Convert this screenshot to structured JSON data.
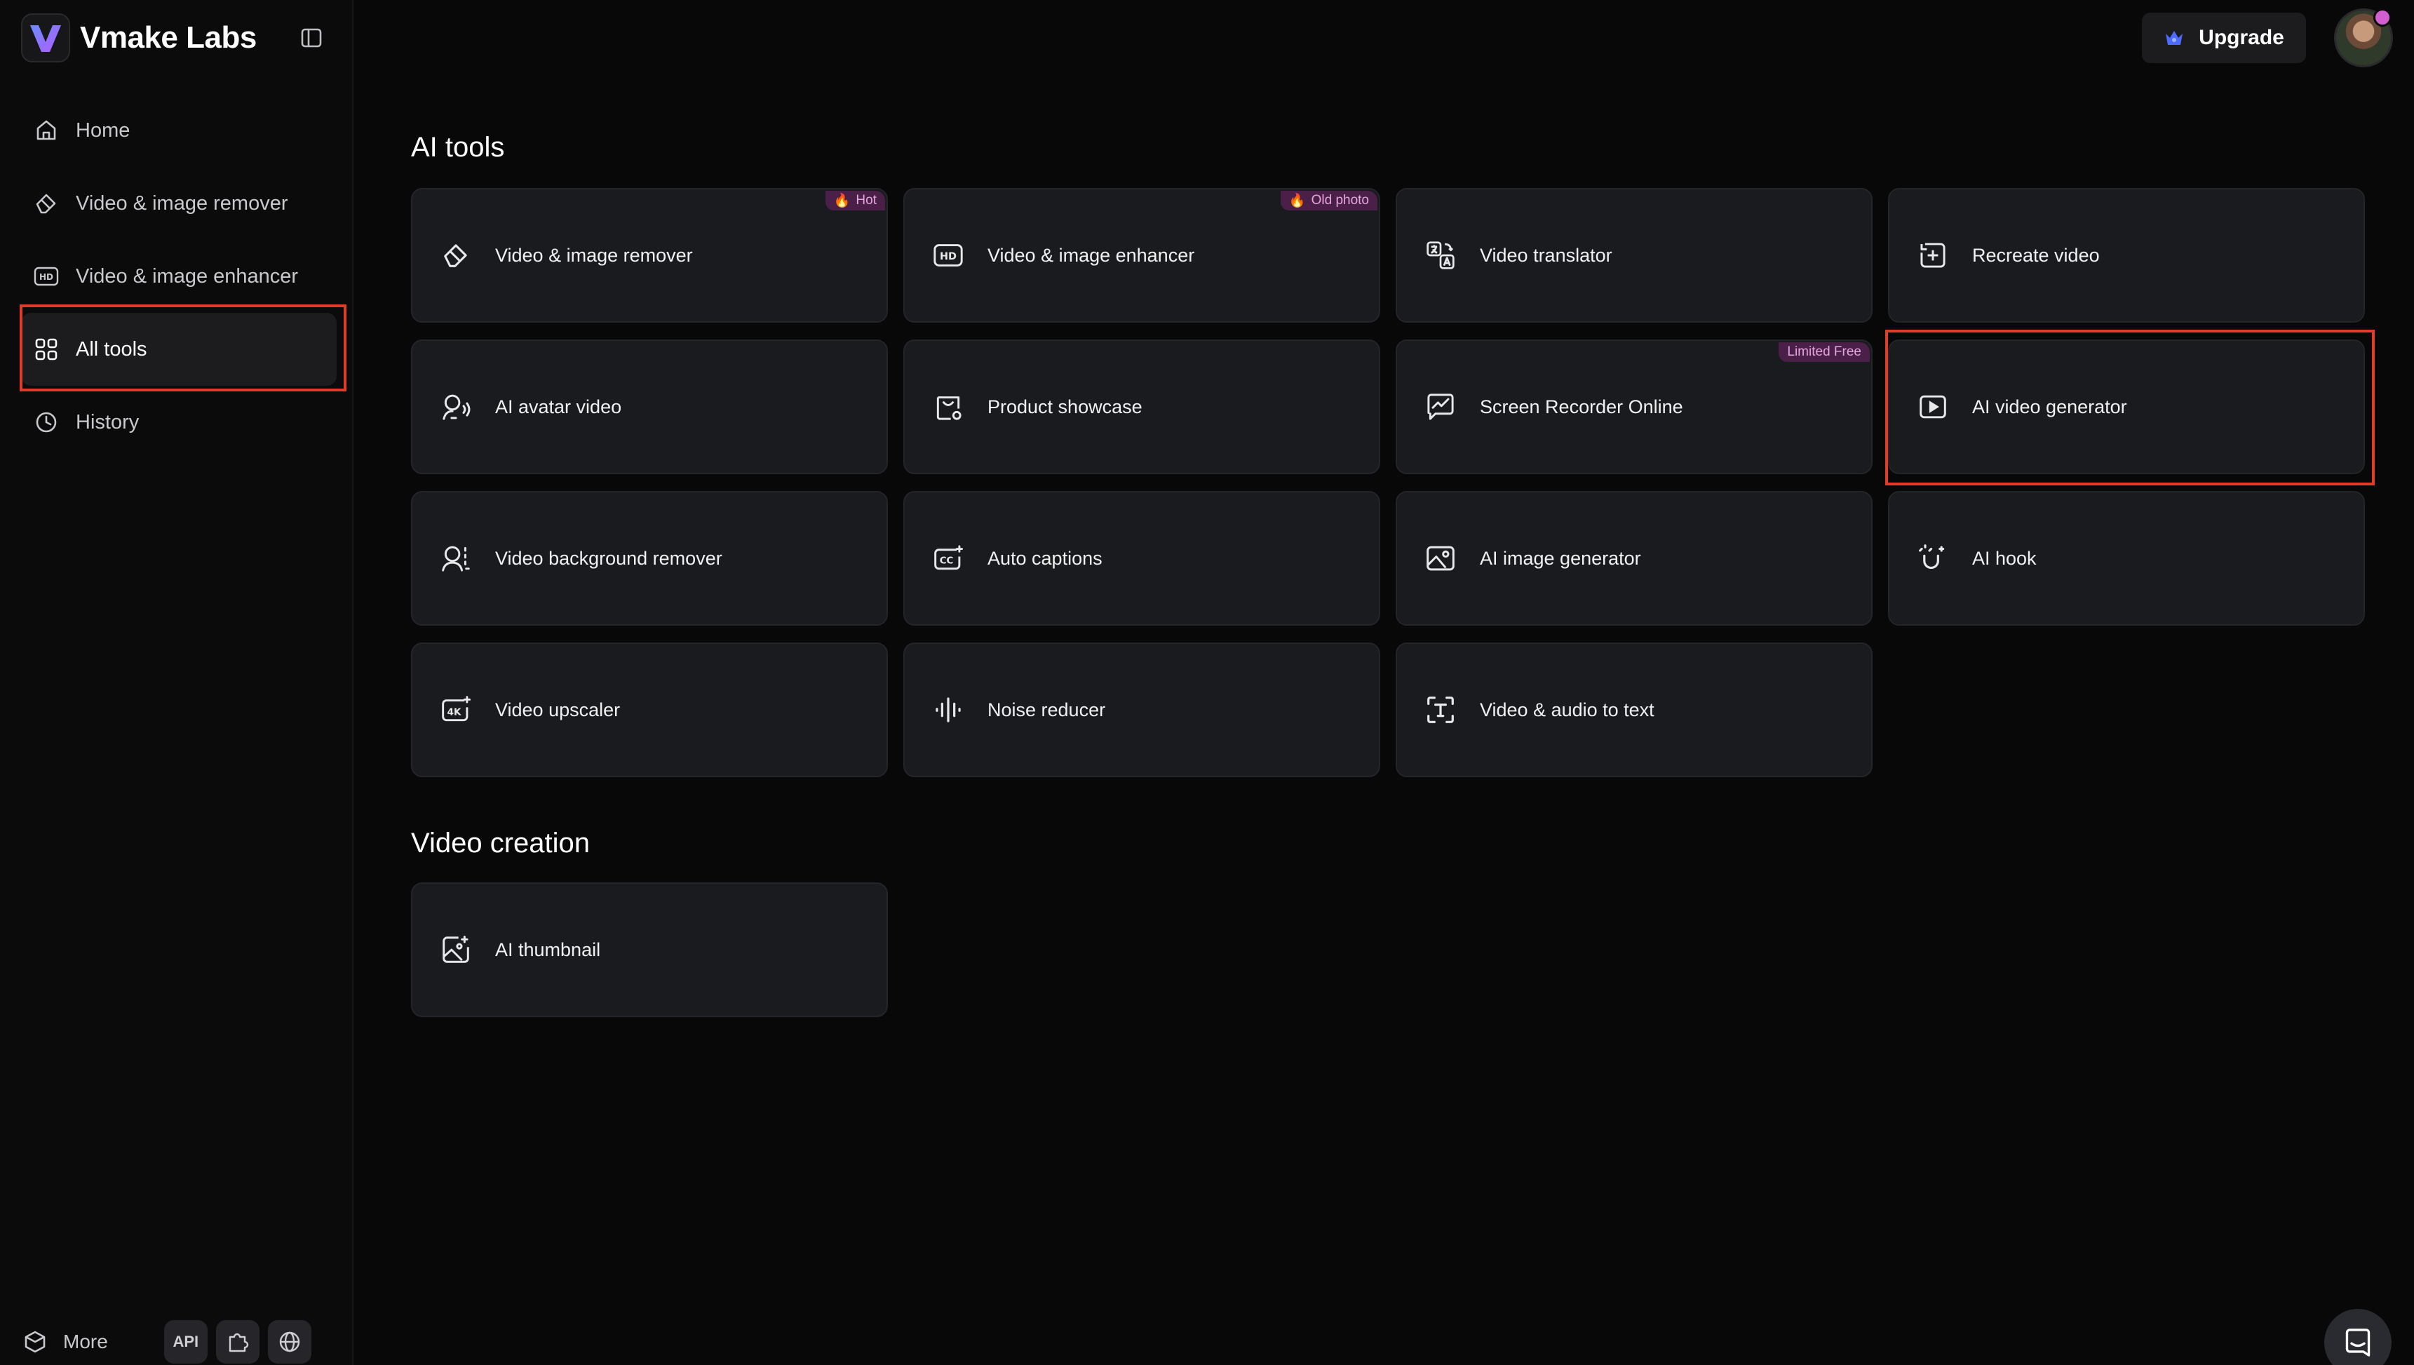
{
  "brand": {
    "name": "Vmake Labs"
  },
  "sidebar": {
    "items": [
      {
        "label": "Home",
        "icon": "home-icon"
      },
      {
        "label": "Video & image remover",
        "icon": "eraser-icon"
      },
      {
        "label": "Video & image enhancer",
        "icon": "hd-icon"
      },
      {
        "label": "All tools",
        "icon": "grid-icon",
        "active": true
      },
      {
        "label": "History",
        "icon": "clock-icon"
      }
    ],
    "footer": {
      "more_label": "More",
      "api_label": "API"
    }
  },
  "topbar": {
    "upgrade_label": "Upgrade"
  },
  "sections": {
    "ai_tools_title": "AI tools",
    "video_creation_title": "Video creation"
  },
  "tools": [
    {
      "label": "Video & image remover",
      "badge": "Hot",
      "icon": "eraser-icon"
    },
    {
      "label": "Video & image enhancer",
      "badge": "Old photo",
      "icon": "hd-icon"
    },
    {
      "label": "Video translator",
      "icon": "translate-icon"
    },
    {
      "label": "Recreate video",
      "icon": "recreate-icon"
    },
    {
      "label": "AI avatar video",
      "icon": "avatar-voice-icon"
    },
    {
      "label": "Product showcase",
      "icon": "shopping-bag-icon"
    },
    {
      "label": "Screen Recorder Online",
      "badge": "Limited Free",
      "icon": "screen-chart-icon"
    },
    {
      "label": "AI video generator",
      "icon": "play-icon",
      "highlighted": true
    },
    {
      "label": "Video background remover",
      "icon": "person-dashed-icon"
    },
    {
      "label": "Auto captions",
      "icon": "cc-icon"
    },
    {
      "label": "AI image generator",
      "icon": "image-icon"
    },
    {
      "label": "AI hook",
      "icon": "magnet-icon"
    },
    {
      "label": "Video upscaler",
      "icon": "4k-icon"
    },
    {
      "label": "Noise reducer",
      "icon": "waveform-icon"
    },
    {
      "label": "Video & audio to text",
      "icon": "text-scan-icon"
    }
  ],
  "creation_tools": [
    {
      "label": "AI thumbnail",
      "icon": "thumbnail-icon"
    }
  ],
  "colors": {
    "background": "#080808",
    "card": "#1a1b1e",
    "highlight": "#e03c2a",
    "badge_bg": "#4a1f48",
    "badge_text": "#e6a6df",
    "brand_purple": "#7b5cff"
  }
}
